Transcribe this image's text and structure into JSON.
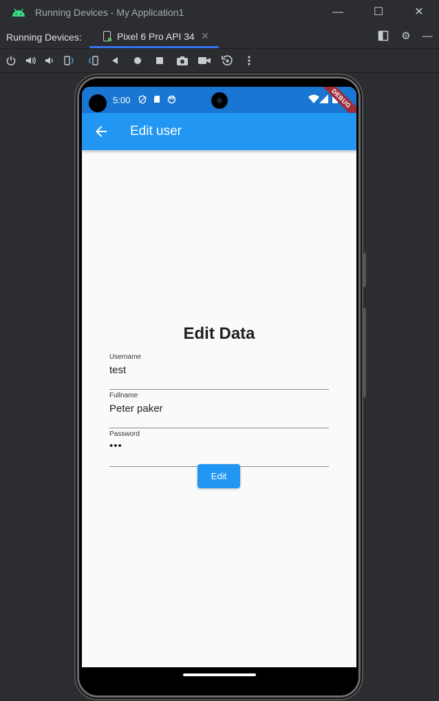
{
  "window": {
    "title": "Running Devices - My Application1",
    "minimize": "—",
    "maximize": "☐",
    "close": "✕"
  },
  "panel": {
    "label": "Running Devices:",
    "device_tab": "Pixel 6 Pro API 34",
    "tab_close": "✕"
  },
  "phone": {
    "status_time": "5:00",
    "debug_banner": "DEBUG",
    "app_bar_title": "Edit user",
    "form_title": "Edit Data",
    "fields": [
      {
        "label": "Username",
        "value": "test"
      },
      {
        "label": "Fullname",
        "value": "Peter paker"
      },
      {
        "label": "Password",
        "value": "•••"
      }
    ],
    "edit_button": "Edit"
  },
  "colors": {
    "status_bar": "#1976d2",
    "app_bar": "#2196f3",
    "button": "#2196f3",
    "debug_ribbon": "#9e2d39"
  }
}
